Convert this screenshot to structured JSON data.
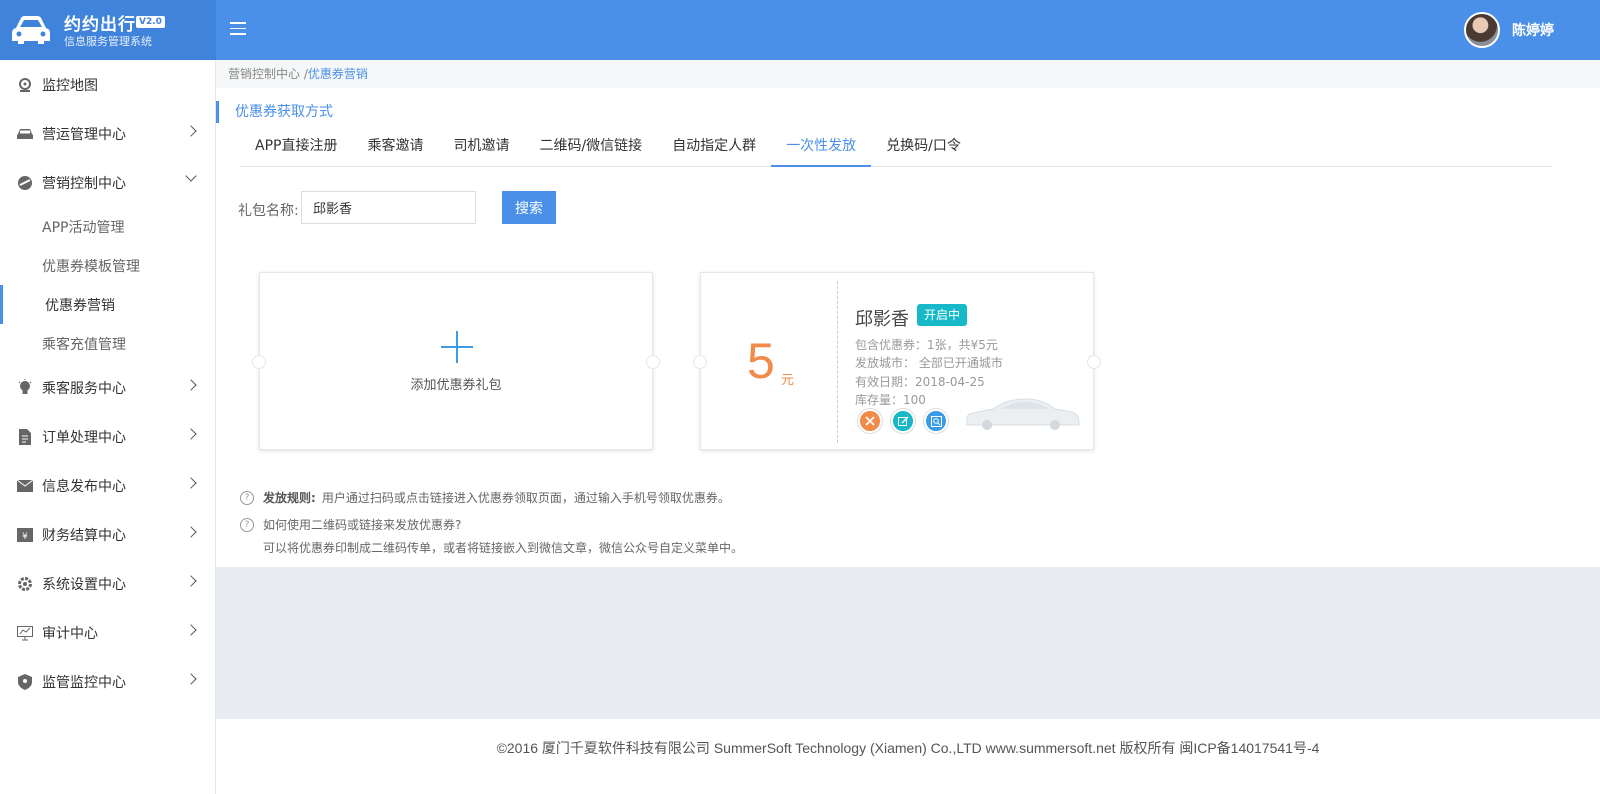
{
  "brand": {
    "title": "约约出行",
    "version": "V2.0",
    "subtitle": "信息服务管理系统"
  },
  "header": {
    "username": "陈婷婷"
  },
  "sidebar": {
    "items": [
      {
        "label": "监控地图",
        "icon": "map-pin-icon"
      },
      {
        "label": "营运管理中心",
        "icon": "car-icon"
      },
      {
        "label": "营销控制中心",
        "icon": "marketing-icon",
        "expanded": true,
        "children": [
          "APP活动管理",
          "优惠券模板管理",
          "优惠券营销",
          "乘客充值管理"
        ]
      },
      {
        "label": "乘客服务中心",
        "icon": "lightbulb-icon"
      },
      {
        "label": "订单处理中心",
        "icon": "document-icon"
      },
      {
        "label": "信息发布中心",
        "icon": "mail-icon"
      },
      {
        "label": "财务结算中心",
        "icon": "finance-icon"
      },
      {
        "label": "系统设置中心",
        "icon": "gear-icon"
      },
      {
        "label": "审计中心",
        "icon": "monitor-chart-icon"
      },
      {
        "label": "监管监控中心",
        "icon": "shield-icon"
      }
    ]
  },
  "breadcrumb": {
    "parent": "营销控制中心 /",
    "current": "优惠券营销"
  },
  "section_title": "优惠券获取方式",
  "tabs": [
    "APP直接注册",
    "乘客邀请",
    "司机邀请",
    "二维码/微信链接",
    "自动指定人群",
    "一次性发放",
    "兑换码/口令"
  ],
  "active_tab": "一次性发放",
  "search": {
    "label": "礼包名称:",
    "value": "邱影香",
    "button": "搜索"
  },
  "add_card": {
    "label": "添加优惠券礼包"
  },
  "coupon": {
    "amount": "5",
    "unit": "元",
    "name": "邱影香",
    "status": "开启中",
    "contains": "包含优惠券：1张，共¥5元",
    "city": "发放城市： 全部已开通城市",
    "valid": "有效日期：2018-04-25",
    "stock": "库存量：100",
    "colors": {
      "delete": "#f28b4a",
      "edit": "#17b8c8",
      "view": "#3a9be6"
    }
  },
  "rules": {
    "rule1_label": "发放规则:",
    "rule1_text": "用户通过扫码或点击链接进入优惠券领取页面，通过输入手机号领取优惠券。",
    "rule2_question": "如何使用二维码或链接来发放优惠券?",
    "rule2_answer": "可以将优惠券印制成二维码传单，或者将链接嵌入到微信文章，微信公众号自定义菜单中。"
  },
  "footer": "©2016 厦门千夏软件科技有限公司 SummerSoft Technology (Xiamen) Co.,LTD www.summersoft.net 版权所有 闽ICP备14017541号-4"
}
